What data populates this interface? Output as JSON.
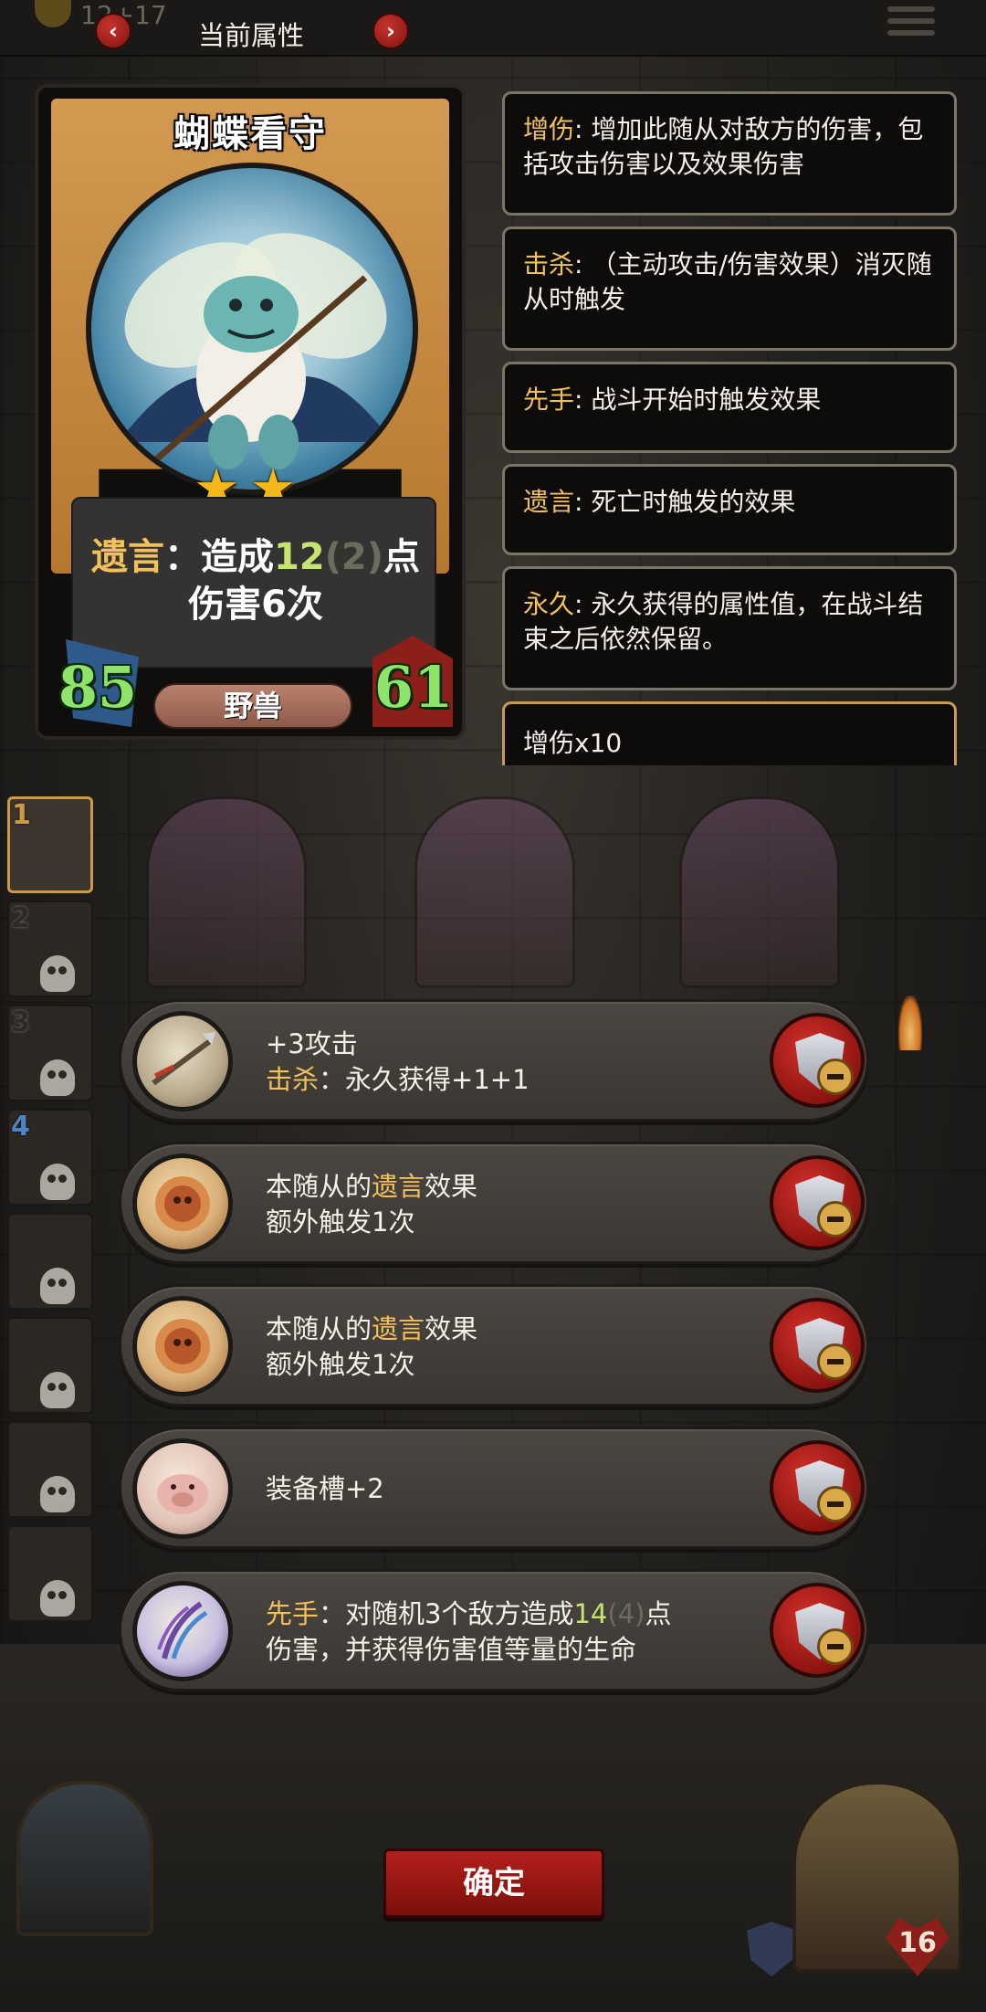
{
  "topbar": {
    "gold_text": "12+17",
    "title": "当前属性",
    "prev_label": "‹",
    "next_label": "›"
  },
  "card": {
    "name": "蝴蝶看守",
    "stars": 2,
    "desc_keyword": "遗言",
    "desc_part1": "：造成",
    "desc_num": "12",
    "desc_num_dim": "(2)",
    "desc_part2": "点",
    "desc_line2": "伤害6次",
    "attack": "85",
    "health": "61",
    "race": "野兽"
  },
  "keywords": [
    {
      "name": "增伤",
      "text": ": 增加此随从对敌方的伤害，包括攻击伤害以及效果伤害"
    },
    {
      "name": "击杀",
      "text": ": （主动攻击/伤害效果）消灭随从时触发"
    },
    {
      "name": "先手",
      "text": ": 战斗开始时触发效果"
    },
    {
      "name": "遗言",
      "text": ": 死亡时触发的效果"
    },
    {
      "name": "永久",
      "text": ": 永久获得的属性值，在战斗结束之后依然保留。"
    }
  ],
  "bonus_panel": {
    "text": "增伤x10"
  },
  "roster": [
    {
      "num": "1"
    },
    {
      "num": "2"
    },
    {
      "num": "3"
    },
    {
      "num": "4"
    },
    {
      "num": ""
    },
    {
      "num": ""
    },
    {
      "num": ""
    },
    {
      "num": ""
    }
  ],
  "equipment": [
    {
      "line1": "+3攻击",
      "kw": "击杀",
      "line2_rest": "：永久获得+1+1"
    },
    {
      "line1_pre": "本随从的",
      "kw": "遗言",
      "line1_post": "效果",
      "line2": "额外触发1次"
    },
    {
      "line1_pre": "本随从的",
      "kw": "遗言",
      "line1_post": "效果",
      "line2": "额外触发1次"
    },
    {
      "line1": "装备槽+2"
    },
    {
      "kw": "先手",
      "line1_mid": "：对随机3个敌方造成",
      "num": "14",
      "num_dim": "(4)",
      "line1_end": "点",
      "line2": "伤害，并获得伤害值等量的生命"
    }
  ],
  "icons": {
    "equip_icons": [
      "spear-icon",
      "seal-icon",
      "seal-icon",
      "pig-icon",
      "claw-icon"
    ],
    "unequip": "unequip-shield-icon"
  },
  "confirm_label": "确定",
  "hero": {
    "hp": "16"
  },
  "colors": {
    "keyword": "#f2c15a",
    "number_green": "#c5e56f",
    "button_red": "#b3201b",
    "stat_green": "#8ee36a"
  }
}
